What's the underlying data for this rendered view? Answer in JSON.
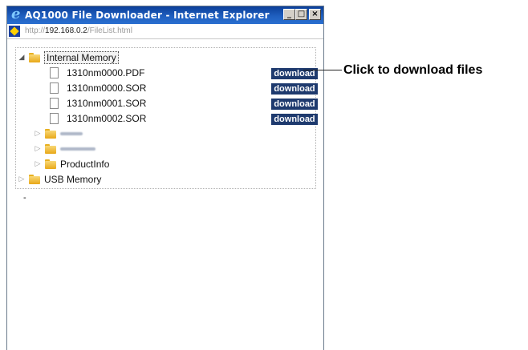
{
  "window": {
    "title": "AQ1000 File Downloader - Internet Explorer",
    "buttons": [
      "_",
      "□",
      "×"
    ]
  },
  "address": {
    "scheme": "http://",
    "host": "192.168.0.2",
    "path": "/FileList.html"
  },
  "tree": {
    "root": {
      "label": "Internal Memory",
      "expanded": true
    },
    "files": [
      {
        "name": "1310nm0000.PDF"
      },
      {
        "name": "1310nm0000.SOR"
      },
      {
        "name": "1310nm0001.SOR"
      },
      {
        "name": "1310nm0002.SOR"
      }
    ],
    "download_label": "download",
    "subfolders": [
      {
        "label": ""
      },
      {
        "label": ""
      },
      {
        "label": "ProductInfo"
      }
    ],
    "usb": {
      "label": "USB Memory"
    }
  },
  "stray_text": "-",
  "callout": {
    "text": "Click to download files"
  }
}
